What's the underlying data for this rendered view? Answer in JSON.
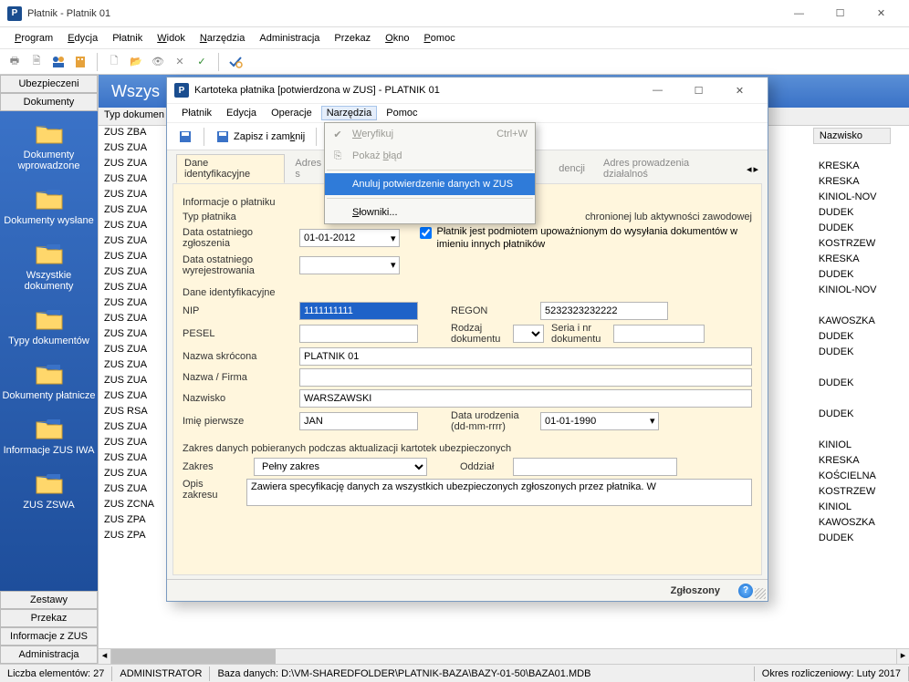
{
  "app": {
    "title": "Płatnik - Platnik 01"
  },
  "menu": {
    "program": "Program",
    "edycja": "Edycja",
    "platnik": "Płatnik",
    "widok": "Widok",
    "narzedzia": "Narzędzia",
    "administracja": "Administracja",
    "przekaz": "Przekaz",
    "okno": "Okno",
    "pomoc": "Pomoc"
  },
  "sidebar": {
    "tab_ubezpieczeni": "Ubezpieczeni",
    "tab_dokumenty": "Dokumenty",
    "items": [
      {
        "label": "Dokumenty wprowadzone"
      },
      {
        "label": "Dokumenty wysłane"
      },
      {
        "label": "Wszystkie dokumenty"
      },
      {
        "label": "Typy dokumentów"
      },
      {
        "label": "Dokumenty płatnicze"
      },
      {
        "label": "Informacje ZUS IWA"
      },
      {
        "label": "ZUS ZSWA"
      }
    ],
    "tab_zestawy": "Zestawy",
    "tab_przekaz": "Przekaz",
    "tab_informacje": "Informacje z ZUS",
    "tab_administracja": "Administracja"
  },
  "content": {
    "header": "Wszys",
    "col_typ": "Typ dokumen",
    "col_nazwisko": "Nazwisko",
    "rows": [
      "ZUS ZBA",
      "ZUS ZUA",
      "ZUS ZUA",
      "ZUS ZUA",
      "ZUS ZUA",
      "ZUS ZUA",
      "ZUS ZUA",
      "ZUS ZUA",
      "ZUS ZUA",
      "ZUS ZUA",
      "ZUS ZUA",
      "ZUS ZUA",
      "ZUS ZUA",
      "ZUS ZUA",
      "ZUS ZUA",
      "ZUS ZUA",
      "ZUS ZUA",
      "ZUS ZUA",
      "ZUS RSA",
      "ZUS ZUA",
      "ZUS ZUA",
      "ZUS ZUA",
      "ZUS ZUA",
      "ZUS ZUA",
      "ZUS ZCNA",
      "ZUS ZPA",
      "ZUS ZPA"
    ],
    "nazwisko": [
      "",
      "KRESKA",
      "KRESKA",
      "KINIOL-NOV",
      "DUDEK",
      "DUDEK",
      "KOSTRZEW",
      "KRESKA",
      "DUDEK",
      "KINIOL-NOV",
      "",
      "KAWOSZKA",
      "DUDEK",
      "DUDEK",
      "",
      "DUDEK",
      "",
      "DUDEK",
      "",
      "KINIOL",
      "KRESKA",
      "KOŚCIELNA",
      "KOSTRZEW",
      "KINIOL",
      "KAWOSZKA",
      "DUDEK",
      ""
    ]
  },
  "status": {
    "count": "Liczba elementów: 27",
    "user": "ADMINISTRATOR",
    "db": "Baza danych: D:\\VM-SHAREDFOLDER\\PLATNIK-BAZA\\BAZY-01-50\\BAZA01.MDB",
    "period": "Okres rozliczeniowy: Luty 2017"
  },
  "modal": {
    "title": "Kartoteka płatnika [potwierdzona w ZUS] - PLATNIK 01",
    "menu": {
      "platnik": "Płatnik",
      "edycja": "Edycja",
      "operacje": "Operacje",
      "narzedzia": "Narzędzia",
      "pomoc": "Pomoc"
    },
    "save": "Zapisz i zamknij",
    "tabs": {
      "dane": "Dane identyfikacyjne",
      "adres": "Adres s",
      "dencji": "dencji",
      "adres_prow": "Adres prowadzenia działalnoś"
    },
    "sec_info": "Informacje o płatniku",
    "typ_platnika_lbl": "Typ płatnika",
    "typ_platnika_note": "chronionej lub aktywności zawodowej",
    "data_zgl_lbl": "Data ostatniego zgłoszenia",
    "data_zgl_val": "01-01-2012",
    "data_wyr_lbl": "Data ostatniego wyrejestrowania",
    "chk_label": "Płatnik jest podmiotem upoważnionym do wysyłania dokumentów w imieniu innych płatników",
    "sec_dane": "Dane identyfikacyjne",
    "nip_lbl": "NIP",
    "nip_val": "1111111111",
    "regon_lbl": "REGON",
    "regon_val": "5232323232222",
    "pesel_lbl": "PESEL",
    "rodzaj_lbl": "Rodzaj dokumentu",
    "seria_lbl": "Seria i nr dokumentu",
    "nazwa_skr_lbl": "Nazwa skrócona",
    "nazwa_skr_val": "PLATNIK 01",
    "nazwa_firma_lbl": "Nazwa / Firma",
    "nazwisko_lbl": "Nazwisko",
    "nazwisko_val": "WARSZAWSKI",
    "imie_lbl": "Imię pierwsze",
    "imie_val": "JAN",
    "data_ur_lbl": "Data urodzenia (dd-mm-rrrr)",
    "data_ur_val": "01-01-1990",
    "sec_zakres": "Zakres danych pobieranych podczas aktualizacji kartotek ubezpieczonych",
    "zakres_lbl": "Zakres",
    "zakres_val": "Pełny zakres",
    "oddzial_lbl": "Oddział",
    "opis_lbl": "Opis zakresu",
    "opis_val": "Zawiera specyfikację danych za wszystkich ubezpieczonych zgłoszonych przez płatnika. W",
    "status": "Zgłoszony"
  },
  "dropdown": {
    "weryfikuj": "Weryfikuj",
    "weryfikuj_sc": "Ctrl+W",
    "pokaz": "Pokaż błąd",
    "anuluj": "Anuluj potwierdzenie danych w ZUS",
    "slowniki": "Słowniki..."
  }
}
